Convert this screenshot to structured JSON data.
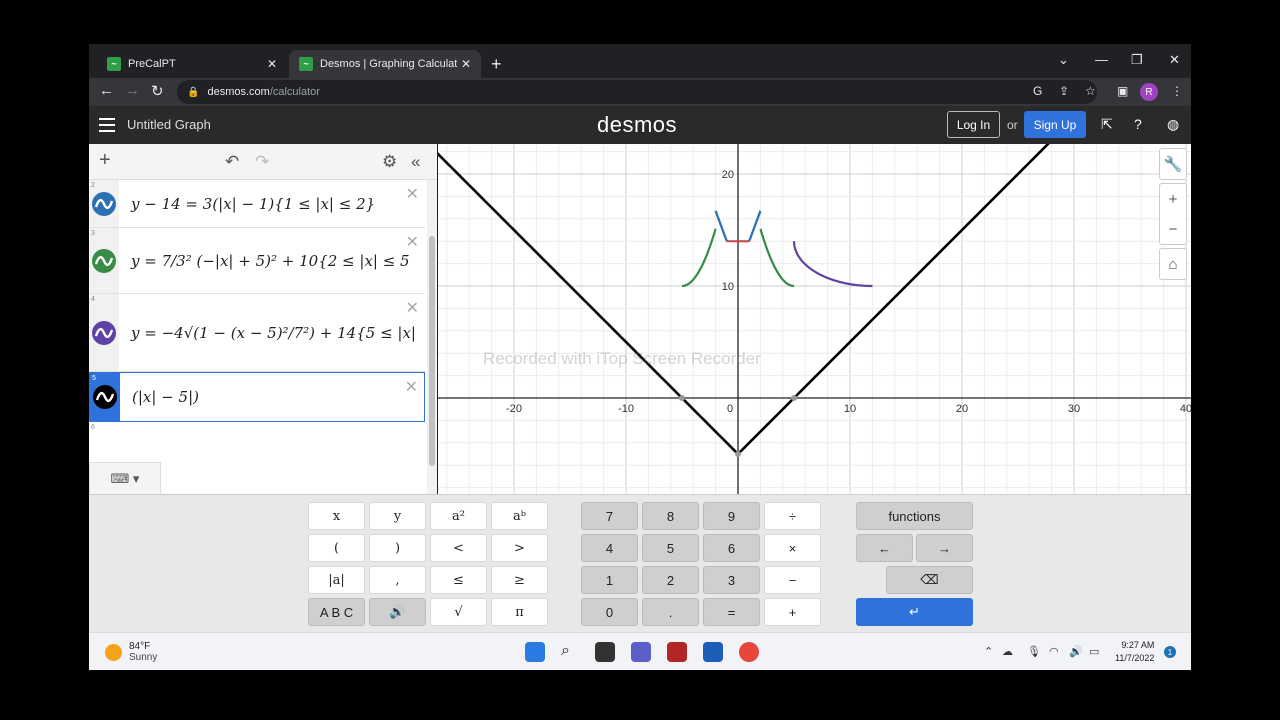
{
  "browser": {
    "tabs": [
      {
        "title": "PreCalPT",
        "active": false
      },
      {
        "title": "Desmos | Graphing Calculator",
        "active": true
      }
    ],
    "url_host": "desmos.com",
    "url_path": "/calculator",
    "profile_initial": "R"
  },
  "desmos": {
    "graph_title": "Untitled Graph",
    "logo": "desmos",
    "login_label": "Log In",
    "or_label": "or",
    "signup_label": "Sign Up"
  },
  "expressions": [
    {
      "num": "2",
      "color": "#2d70b3",
      "formula": "y − 14 = 3(|x| − 1){1 ≤ |x| ≤ 2}"
    },
    {
      "num": "3",
      "color": "#388c46",
      "formula": "y = 7/3² (−|x| + 5)² + 10{2 ≤ |x| ≤ 5"
    },
    {
      "num": "4",
      "color": "#6042a6",
      "formula": "y = −4√(1 − (x − 5)²/7²) + 14{5 ≤ |x|"
    },
    {
      "num": "5",
      "color": "#000000",
      "formula": "(|x| − 5|)",
      "focused": true
    },
    {
      "num": "6",
      "color": "",
      "formula": ""
    }
  ],
  "graph": {
    "x_ticks": [
      "-20",
      "-10",
      "0",
      "10",
      "20",
      "30",
      "40"
    ],
    "y_ticks": [
      "20",
      "10"
    ],
    "watermark": "Recorded with iTop Screen Recorder"
  },
  "keypad": {
    "left": [
      "x",
      "y",
      "a²",
      "aᵇ",
      "(",
      ")",
      "<",
      ">",
      "|a|",
      ",",
      "≤",
      "≥",
      "A B C",
      "🔊",
      "√",
      "π"
    ],
    "middle": [
      "7",
      "8",
      "9",
      "÷",
      "4",
      "5",
      "6",
      "×",
      "1",
      "2",
      "3",
      "−",
      "0",
      ".",
      "=",
      "+"
    ],
    "functions_label": "functions",
    "left_arrow": "←",
    "right_arrow": "→",
    "backspace": "⌫",
    "enter": "↵"
  },
  "taskbar": {
    "temperature": "84°F",
    "condition": "Sunny",
    "time": "9:27 AM",
    "date": "11/7/2022",
    "notifications": "1"
  }
}
